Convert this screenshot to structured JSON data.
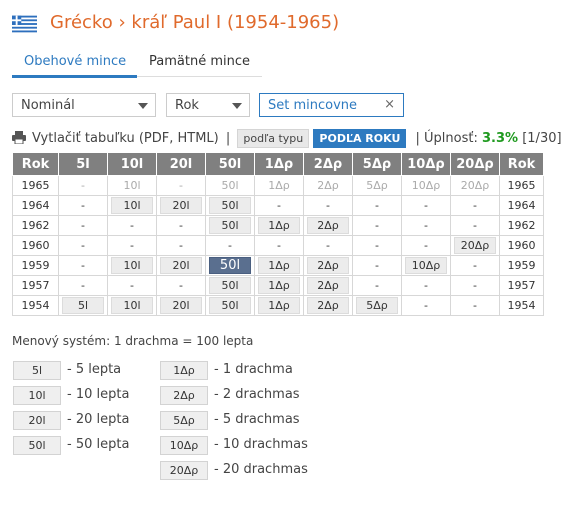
{
  "header": {
    "country": "Grécko",
    "separator": "›",
    "period": "kráľ Paul I (1954-1965)"
  },
  "tabs": [
    {
      "label": "Obehové mince",
      "active": true
    },
    {
      "label": "Pamätné mince",
      "active": false
    }
  ],
  "filters": {
    "denomination": "Nominál",
    "year": "Rok",
    "set": "Set mincovne",
    "clear": "×"
  },
  "toolbar": {
    "print": "Vytlačiť tabuľku (PDF, HTML)",
    "divider": "|",
    "by_type": "podľa typu",
    "by_year": "PODĽA ROKU",
    "completeness_label": "| Úplnosť:",
    "completeness_pct": "3.3%",
    "completeness_count": "[1/30]"
  },
  "table": {
    "headers": [
      "Rok",
      "5l",
      "10l",
      "20l",
      "50l",
      "1Δρ",
      "2Δρ",
      "5Δρ",
      "10Δρ",
      "20Δρ",
      "Rok"
    ],
    "rows": [
      {
        "year": "1965",
        "gray": true,
        "cells": [
          "-",
          "10l",
          "-",
          "50l",
          "1Δρ",
          "2Δρ",
          "5Δρ",
          "10Δρ",
          "20Δρ"
        ]
      },
      {
        "year": "1964",
        "gray": false,
        "cells": [
          "-",
          "10l",
          "20l",
          "50l",
          "-",
          "-",
          "-",
          "-",
          "-"
        ]
      },
      {
        "year": "1962",
        "gray": false,
        "cells": [
          "-",
          "-",
          "-",
          "50l",
          "1Δρ",
          "2Δρ",
          "-",
          "-",
          "-"
        ]
      },
      {
        "year": "1960",
        "gray": false,
        "cells": [
          "-",
          "-",
          "-",
          "-",
          "-",
          "-",
          "-",
          "-",
          "20Δρ"
        ]
      },
      {
        "year": "1959",
        "gray": false,
        "cells": [
          "-",
          "10l",
          "20l",
          "50l",
          "1Δρ",
          "2Δρ",
          "-",
          "10Δρ",
          "-"
        ],
        "selected": 3
      },
      {
        "year": "1957",
        "gray": false,
        "cells": [
          "-",
          "-",
          "-",
          "50l",
          "1Δρ",
          "2Δρ",
          "-",
          "-",
          "-"
        ]
      },
      {
        "year": "1954",
        "gray": false,
        "cells": [
          "5l",
          "10l",
          "20l",
          "50l",
          "1Δρ",
          "2Δρ",
          "5Δρ",
          "-",
          "-"
        ]
      }
    ]
  },
  "legend": {
    "system": "Menový systém: 1 drachma = 100 lepta",
    "left": [
      {
        "btn": "5l",
        "text": "- 5 lepta"
      },
      {
        "btn": "10l",
        "text": "- 10 lepta"
      },
      {
        "btn": "20l",
        "text": "- 20 lepta"
      },
      {
        "btn": "50l",
        "text": "- 50 lepta"
      }
    ],
    "right": [
      {
        "btn": "1Δρ",
        "text": "- 1 drachma"
      },
      {
        "btn": "2Δρ",
        "text": "- 2 drachmas"
      },
      {
        "btn": "5Δρ",
        "text": "- 5 drachmas"
      },
      {
        "btn": "10Δρ",
        "text": "- 10 drachmas"
      },
      {
        "btn": "20Δρ",
        "text": "- 20 drachmas"
      }
    ]
  },
  "colors": {
    "title": "#e06a2c",
    "accent": "#2d7ac0",
    "header_bg": "#808080",
    "selected_cell": "#5a6f8f",
    "completeness": "#1f9a1f"
  },
  "icons": {
    "flag": "greece-flag-icon",
    "print": "printer-icon",
    "caret": "chevron-down-icon",
    "clear": "close-icon"
  }
}
